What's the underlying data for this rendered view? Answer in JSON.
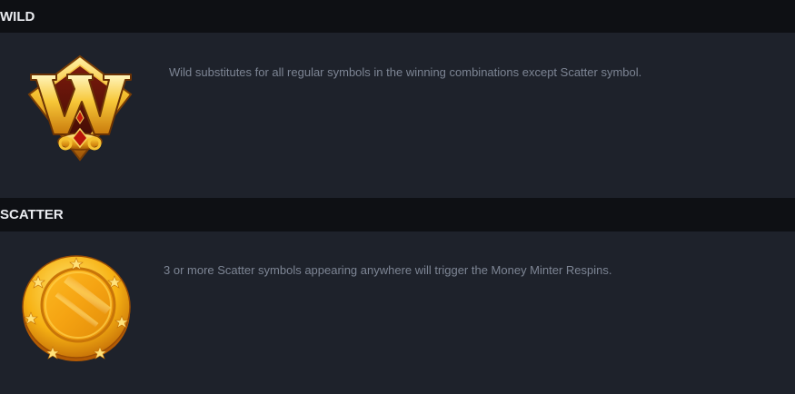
{
  "wild": {
    "title": "WILD",
    "description": "Wild substitutes for all regular symbols in the winning combinations except Scatter symbol.",
    "icon": "wild-w-emblem-icon"
  },
  "scatter": {
    "title": "SCATTER",
    "description": "3 or more Scatter symbols appearing anywhere will trigger the Money Minter Respins.",
    "icon": "gold-coin-icon"
  },
  "colors": {
    "background": "#1e222b",
    "header_background": "#0e1014",
    "header_text": "#e9ebef",
    "description_text": "#7d8594",
    "gold": "#f2b01e"
  }
}
